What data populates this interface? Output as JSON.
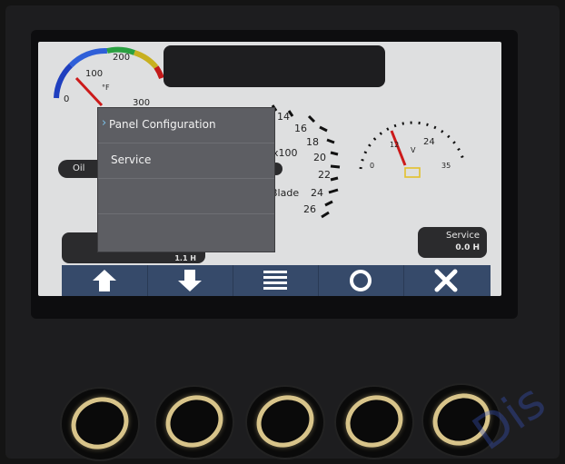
{
  "temp_gauge": {
    "unit": "°F",
    "ticks": [
      "0",
      "100",
      "200",
      "300"
    ]
  },
  "tach_gauge": {
    "ticks": [
      "14",
      "16",
      "18",
      "20",
      "22",
      "24",
      "26"
    ],
    "multiplier": "x100",
    "label": "Blade"
  },
  "volt_gauge": {
    "unit": "V",
    "ticks": [
      "0",
      "12",
      "24",
      "35"
    ]
  },
  "oil_pill": {
    "label": "Oil"
  },
  "hour_meter": {
    "value": "1.1 H"
  },
  "service_pill": {
    "title": "Service",
    "value": "0.0 H"
  },
  "menu": {
    "items": [
      {
        "label": "Panel Configuration",
        "selected": true
      },
      {
        "label": "Service",
        "selected": false
      },
      {
        "label": "",
        "selected": false
      },
      {
        "label": "",
        "selected": false
      }
    ]
  },
  "softkeys": [
    {
      "icon": "arrow-up-icon"
    },
    {
      "icon": "arrow-down-icon"
    },
    {
      "icon": "menu-lines-icon"
    },
    {
      "icon": "circle-icon"
    },
    {
      "icon": "close-x-icon"
    }
  ],
  "watermark": "Dis",
  "colors": {
    "screen_background": "#dedfe0",
    "menu_background": "#5d5e63",
    "softkey_bar": "#364a6a",
    "needle": "#cc1a1a",
    "button_ring": "#d8c48a",
    "battery_icon": "#e3c12b"
  }
}
